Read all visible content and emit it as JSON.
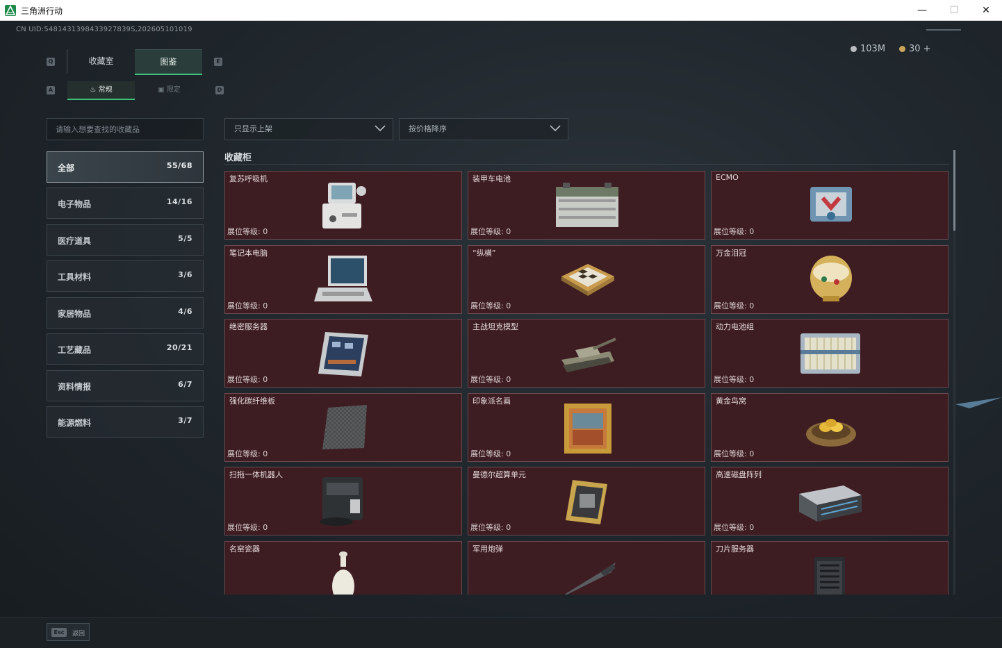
{
  "window": {
    "title": "三角洲行动",
    "minimize": "—",
    "maximize": "☐",
    "close": "✕"
  },
  "header": {
    "uid": "CN UID:5481431398433927839S,202605101019"
  },
  "currency": [
    {
      "value": "103M",
      "color": "#b8bcc0"
    },
    {
      "value": "30 +",
      "color": "#c9a65a"
    }
  ],
  "keyhints": {
    "q": "Q",
    "e": "E",
    "a": "A",
    "d": "D"
  },
  "tabs": {
    "collection": "收藏室",
    "catalog": "图鉴"
  },
  "subtabs": {
    "normal": "常规",
    "limited": "限定"
  },
  "search": {
    "placeholder": "请输入想要查找的收藏品"
  },
  "filters": {
    "shelf": "只显示上架",
    "sort": "按价格降序"
  },
  "categories": [
    {
      "label": "全部",
      "count": "55/68"
    },
    {
      "label": "电子物品",
      "count": "14/16"
    },
    {
      "label": "医疗道具",
      "count": "5/5"
    },
    {
      "label": "工具材料",
      "count": "3/6"
    },
    {
      "label": "家居物品",
      "count": "4/6"
    },
    {
      "label": "工艺藏品",
      "count": "20/21"
    },
    {
      "label": "资料情报",
      "count": "6/7"
    },
    {
      "label": "能源燃料",
      "count": "3/7"
    }
  ],
  "section": {
    "title": "收藏柜"
  },
  "items": [
    {
      "name": "复苏呼吸机",
      "level": "展位等级: 0",
      "icon": "ventilator-icon"
    },
    {
      "name": "装甲车电池",
      "level": "展位等级: 0",
      "icon": "battery-icon"
    },
    {
      "name": "ECMO",
      "level": "展位等级: 0",
      "icon": "ecmo-icon"
    },
    {
      "name": "笔记本电脑",
      "level": "展位等级: 0",
      "icon": "laptop-icon"
    },
    {
      "name": "“纵横”",
      "level": "展位等级: 0",
      "icon": "chessboard-icon"
    },
    {
      "name": "万金泪冠",
      "level": "展位等级: 0",
      "icon": "jewel-egg-icon"
    },
    {
      "name": "绝密服务器",
      "level": "展位等级: 0",
      "icon": "server-icon"
    },
    {
      "name": "主战坦克模型",
      "level": "展位等级: 0",
      "icon": "tank-icon"
    },
    {
      "name": "动力电池组",
      "level": "展位等级: 0",
      "icon": "battery-pack-icon"
    },
    {
      "name": "强化碳纤维板",
      "level": "展位等级: 0",
      "icon": "carbon-plate-icon"
    },
    {
      "name": "印象派名画",
      "level": "展位等级: 0",
      "icon": "painting-icon"
    },
    {
      "name": "黄金鸟窝",
      "level": "展位等级: 0",
      "icon": "golden-nest-icon"
    },
    {
      "name": "扫拖一体机器人",
      "level": "展位等级: 0",
      "icon": "robot-vacuum-icon"
    },
    {
      "name": "曼德尔超算单元",
      "level": "展位等级: 0",
      "icon": "cpu-icon"
    },
    {
      "name": "高速磁盘阵列",
      "level": "展位等级: 0",
      "icon": "disk-array-icon"
    },
    {
      "name": "名窑瓷器",
      "level": "",
      "icon": "vase-icon"
    },
    {
      "name": "军用炮弹",
      "level": "",
      "icon": "shell-icon"
    },
    {
      "name": "刀片服务器",
      "level": "",
      "icon": "blade-server-icon"
    }
  ],
  "footer": {
    "key": "Esc",
    "label": "返回"
  }
}
